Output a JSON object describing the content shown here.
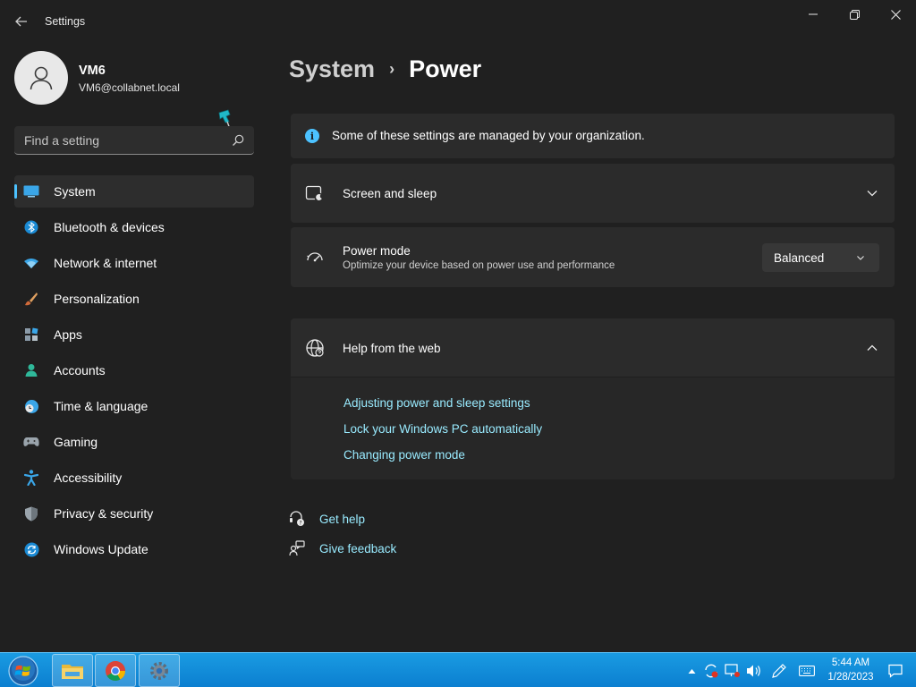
{
  "window": {
    "title": "Settings",
    "colors": {
      "accent": "#4cc2ff",
      "link": "#99ebff",
      "background": "#202020",
      "card": "#2b2b2b"
    }
  },
  "user": {
    "name": "VM6",
    "email": "VM6@collabnet.local"
  },
  "search": {
    "placeholder": "Find a setting"
  },
  "sidebar": {
    "items": [
      {
        "label": "System",
        "icon": "monitor-icon",
        "active": true
      },
      {
        "label": "Bluetooth & devices",
        "icon": "bluetooth-icon"
      },
      {
        "label": "Network & internet",
        "icon": "wifi-icon"
      },
      {
        "label": "Personalization",
        "icon": "brush-icon"
      },
      {
        "label": "Apps",
        "icon": "apps-icon"
      },
      {
        "label": "Accounts",
        "icon": "person-icon"
      },
      {
        "label": "Time & language",
        "icon": "globe-clock-icon"
      },
      {
        "label": "Gaming",
        "icon": "gamepad-icon"
      },
      {
        "label": "Accessibility",
        "icon": "accessibility-icon"
      },
      {
        "label": "Privacy & security",
        "icon": "shield-icon"
      },
      {
        "label": "Windows Update",
        "icon": "update-icon"
      }
    ]
  },
  "breadcrumb": {
    "parent": "System",
    "separator": "›",
    "current": "Power"
  },
  "info": {
    "text": "Some of these settings are managed by your organization."
  },
  "screen_sleep": {
    "title": "Screen and sleep"
  },
  "power_mode": {
    "title": "Power mode",
    "subtitle": "Optimize your device based on power use and performance",
    "selected": "Balanced"
  },
  "help": {
    "title": "Help from the web",
    "links": [
      "Adjusting power and sleep settings",
      "Lock your Windows PC automatically",
      "Changing power mode"
    ]
  },
  "footer": {
    "get_help": "Get help",
    "give_feedback": "Give feedback"
  },
  "taskbar": {
    "apps": [
      "file-explorer-icon",
      "chrome-icon",
      "settings-icon"
    ],
    "time": "5:44 AM",
    "date": "1/28/2023"
  }
}
